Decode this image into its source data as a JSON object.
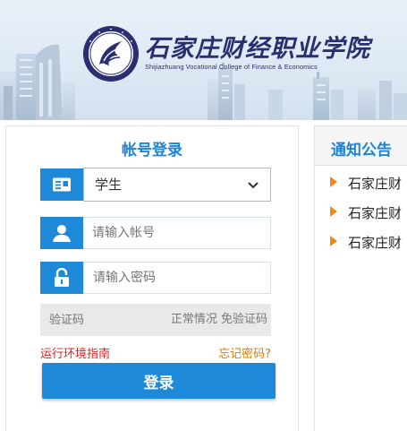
{
  "banner": {
    "school_name": "石家庄财经职业学院",
    "school_name_en": "Shijiazhuang Vocational College of Finance & Economics"
  },
  "login": {
    "title": "帐号登录",
    "role_select": {
      "selected": "学生"
    },
    "account": {
      "placeholder": "请输入帐号"
    },
    "password": {
      "placeholder": "请输入密码"
    },
    "captcha": {
      "placeholder": "验证码",
      "status": "正常情况  免验证码"
    },
    "env_guide_link": "运行环境指南",
    "forgot_password_link": "忘记密码?",
    "submit_label": "登录"
  },
  "notice": {
    "title": "通知公告",
    "items": [
      "石家庄财",
      "石家庄财",
      "石家庄财"
    ]
  },
  "colors": {
    "primary": "#1e88d9",
    "title_blue": "#1f84d4",
    "env_link_red": "#e02222",
    "forgot_link_orange": "#e07a00",
    "notice_arrow": "#f08a1c",
    "school_name_navy": "#2a2f6e"
  },
  "icons": [
    "college-logo-icon",
    "id-card-icon",
    "user-icon",
    "lock-icon",
    "chevron-down-icon",
    "notice-arrow-icon"
  ]
}
